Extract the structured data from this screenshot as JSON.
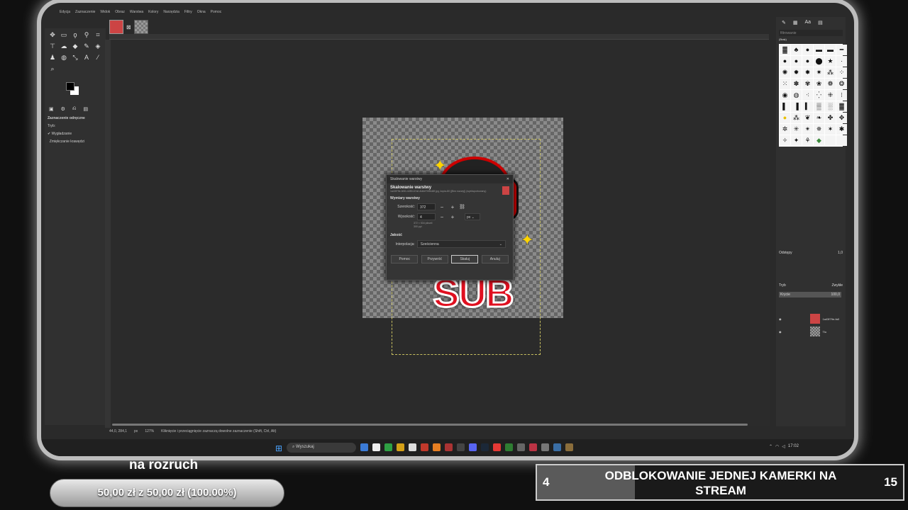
{
  "menu": [
    "Edycja",
    "Zaznaczenie",
    "Widok",
    "Obraz",
    "Warstwa",
    "Kolory",
    "Narzędzia",
    "Filtry",
    "Okna",
    "Pomoc"
  ],
  "toolbox": {
    "options_title": "Zaznaczenie odręczne",
    "mode_label": "Tryb:",
    "antialias": "Wygładzanie",
    "feather": "Zmiękczanie krawędzi"
  },
  "dialog": {
    "title": "Skalowanie warstwy",
    "heading": "Skalowanie warstwy",
    "subtitle": "1a43f79e-fe50-4289-b7a0-8d4ef769bd8f.jpg, kopia-80 ([Bez nazwy]) (wyeksportowany)",
    "section_size": "Wymiary warstwy",
    "width_label": "Szerokość:",
    "width_value": "372",
    "height_label": "Wysokość:",
    "height_value": "4",
    "unit": "px",
    "info1": "372 × 534 pikseli",
    "info2": "300 ppi",
    "section_quality": "Jakość",
    "interp_label": "Interpolacja:",
    "interp_value": "Sześcienna",
    "btn_help": "Pomoc",
    "btn_reset": "Przywróć",
    "btn_scale": "Skaluj",
    "btn_cancel": "Anuluj"
  },
  "canvas": {
    "sticker_text": "SUB"
  },
  "right_panel": {
    "filter_placeholder": "filtrowanie",
    "brush_name": "(Brak)",
    "spacing_label": "Odstępy",
    "spacing_value": "1,0",
    "mode_label": "Tryb",
    "mode_value": "Zwykłe",
    "opacity_label": "Krycie",
    "opacity_value": "100,0",
    "layers": [
      "1a43f79e-fa0",
      "Tło"
    ]
  },
  "status": {
    "coords": "44,0, 284,1",
    "unit": "px",
    "zoom": "127%",
    "hint": "Kliknięcie i przeciągnięcie zaznaczą dowolne zaznaczenie (Shift, Ctrl, Alt)"
  },
  "taskbar": {
    "search": "Wyszukaj",
    "time": "17:02"
  },
  "overlay": {
    "goal1_title": "na rozruch",
    "goal1_text": "50,00 zł  z  50,00 zł  (100.00%)",
    "goal1_progress": 100,
    "goal2_left": "4",
    "goal2_right": "15",
    "goal2_text": "ODBLOKOWANIE JEDNEJ KAMERKI NA STREAM",
    "goal2_progress": 0.2667
  },
  "colors": {
    "accent": "#4aa3ff",
    "sub_red": "#e01020",
    "star": "#ffd400"
  }
}
